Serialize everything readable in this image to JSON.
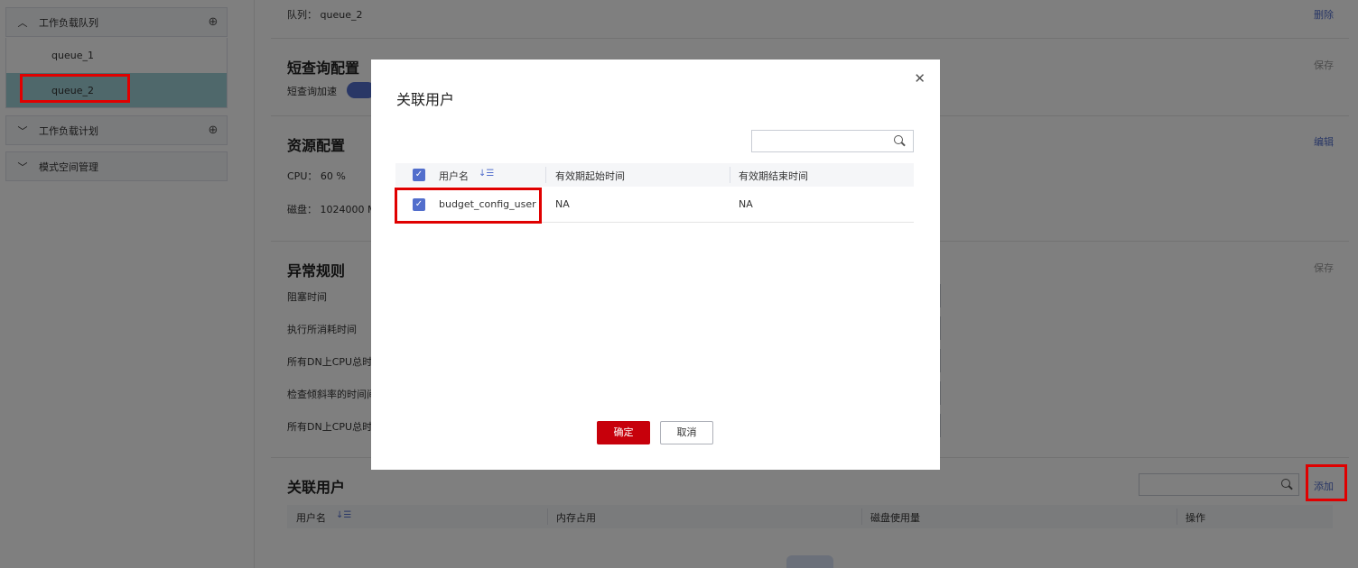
{
  "sidebar": {
    "groups": [
      {
        "label": "工作负载队列",
        "expanded": true
      },
      {
        "label": "工作负载计划",
        "expanded": false
      },
      {
        "label": "模式空间管理",
        "expanded": false
      }
    ],
    "queues": [
      "queue_1",
      "queue_2"
    ],
    "selected_queue": "queue_2"
  },
  "main": {
    "queue_label": "队列：",
    "queue_value": "queue_2",
    "delete_label": "删除",
    "short_query": {
      "title": "短查询配置",
      "save_label": "保存",
      "accel_label": "短查询加速"
    },
    "resource": {
      "title": "资源配置",
      "edit_label": "编辑",
      "cpu_label": "CPU：",
      "cpu_value": "60 %",
      "disk_label": "磁盘：",
      "disk_value": "1024000 MI"
    },
    "exception": {
      "title": "异常规则",
      "save_label": "保存",
      "rules": [
        "阻塞时间",
        "执行所消耗时间",
        "所有DN上CPU总时间",
        "检查倾斜率的时间间",
        "所有DN上CPU总时间"
      ]
    },
    "users": {
      "title": "关联用户",
      "add_label": "添加",
      "columns": [
        "用户名",
        "内存占用",
        "磁盘使用量",
        "操作"
      ]
    }
  },
  "modal": {
    "title": "关联用户",
    "columns": [
      "用户名",
      "有效期起始时间",
      "有效期结束时间"
    ],
    "rows": [
      {
        "username": "budget_config_user",
        "start": "NA",
        "end": "NA",
        "checked": true
      }
    ],
    "confirm_label": "确定",
    "cancel_label": "取消"
  },
  "colors": {
    "accent": "#526ecc",
    "primary_button": "#c7000b",
    "selected_row": "#9fd0d6",
    "highlight_box": "#e00000"
  }
}
